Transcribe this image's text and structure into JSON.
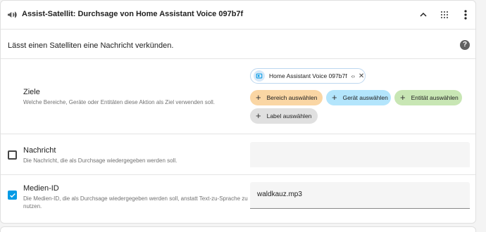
{
  "header": {
    "title": "Assist-Satellit: Durchsage von Home Assistant Voice 097b7f"
  },
  "description": "Lässt einen Satelliten eine Nachricht verkünden.",
  "help_label": "?",
  "targets": {
    "title": "Ziele",
    "description": "Welche Bereiche, Geräte oder Entitäten diese Aktion als Ziel verwenden soll.",
    "selected": {
      "label": "Home Assistant Voice 097b7f",
      "expand": "‹›",
      "remove": "✕"
    },
    "add_buttons": {
      "area": "Bereich auswählen",
      "device": "Gerät auswählen",
      "entity": "Entität auswählen",
      "label": "Label auswählen"
    },
    "plus": "+"
  },
  "message": {
    "title": "Nachricht",
    "description": "Die Nachricht, die als Durchsage wiedergegeben werden soll.",
    "checked": false,
    "value": ""
  },
  "media": {
    "title": "Medien-ID",
    "description": "Die Medien-ID, die als Durchsage wiedergegeben werden soll, anstatt Text-zu-Sprache zu nutzen.",
    "checked": true,
    "value": "waldkauz.mp3"
  },
  "colors": {
    "accent": "#039be5",
    "area_chip": "#fad6a4",
    "device_chip": "#b3e5fc",
    "entity_chip": "#c8e6b4",
    "label_chip": "#e0e0e0"
  }
}
